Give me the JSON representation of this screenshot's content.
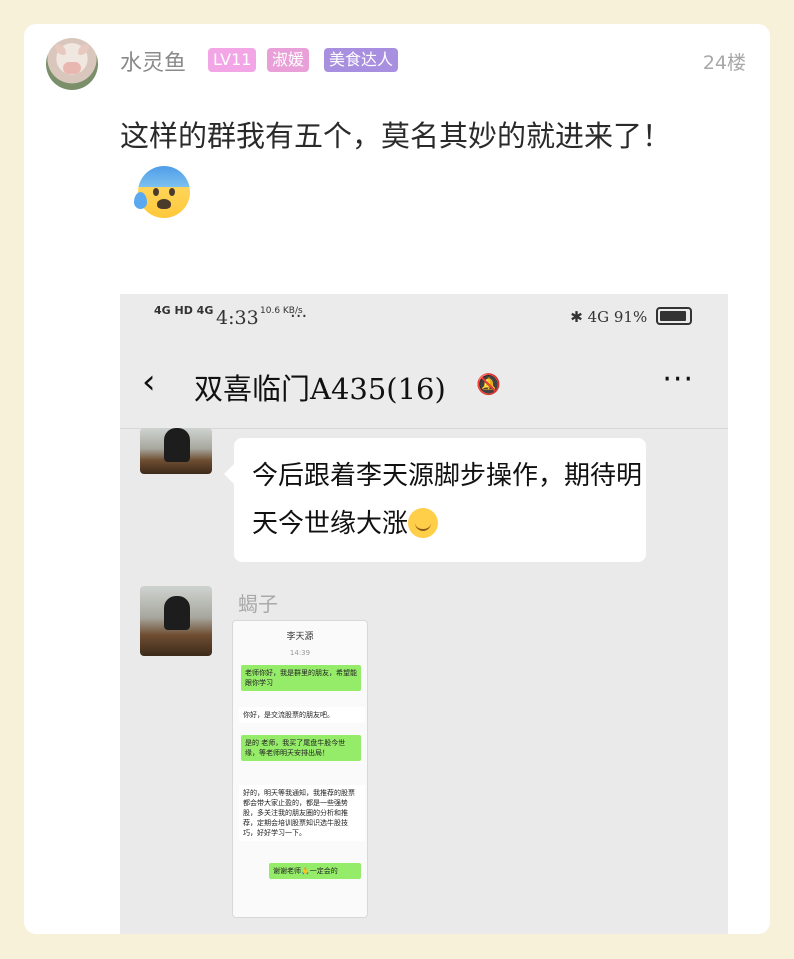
{
  "post": {
    "username": "水灵鱼",
    "badges": [
      {
        "text": "LV11",
        "color": "#f2a6e6"
      },
      {
        "text": "淑媛",
        "color": "#e99fd8"
      },
      {
        "text": "美食达人",
        "color": "#a98fe0"
      }
    ],
    "floor": "24楼",
    "text": "这样的群我有五个，莫名其妙的就进来了！",
    "emoji": "anxious-face-with-sweat"
  },
  "screenshot": {
    "status": {
      "network": "4G HD 4G",
      "time": "4:33",
      "speed": "10.6 KB/s",
      "more": "···",
      "bluetooth_icon": "bluetooth-icon",
      "signal": "4G",
      "battery": "91%"
    },
    "nav": {
      "back": "‹",
      "title": "双喜临门A435(16)",
      "mute_icon": "bell-off-icon",
      "more": "···"
    },
    "messages": [
      {
        "text": "今后跟着李天源脚步操作，期待明天今世缘大涨"
      },
      {
        "sender": "蝎子"
      }
    ],
    "embedded_chat": {
      "title": "李天源",
      "time": "14:39",
      "bubbles": [
        {
          "text": "老师你好，我是群里的朋友，希望能跟你学习",
          "side": "right"
        },
        {
          "text": "你好，是交流股票的朋友吧。",
          "side": "left"
        },
        {
          "text": "是的 老师，我买了尾盘牛股今世缘，等老师明天安排出局！",
          "side": "right"
        },
        {
          "text": "好的，明天等我通知，我推荐的股票都会带大家止盈的，都是一些强势股，多关注我的朋友圈的分析和推荐，定期会培训股票知识选牛股技巧，好好学习一下。",
          "side": "left"
        },
        {
          "text": "谢谢老师🙏一定会的",
          "side": "right"
        }
      ]
    }
  }
}
